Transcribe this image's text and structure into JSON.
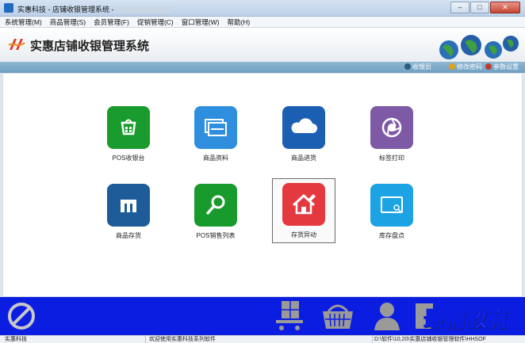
{
  "window": {
    "title": "实惠科技 - 店铺收银管理系统 -",
    "buttons": {
      "minimize": "–",
      "maximize": "□",
      "close": "✕"
    }
  },
  "menu": [
    "系统管理(M)",
    "商品管理(S)",
    "会员管理(F)",
    "促销管理(C)",
    "窗口管理(W)",
    "帮助(H)"
  ],
  "header": {
    "app_name": "实惠店铺收银管理系统",
    "logo_icon": "ss-logo-icon",
    "decor_icon": "globes-icon"
  },
  "toolbar": {
    "cashier": "收银员",
    "change_password": "修改密码",
    "settings": "参数设置"
  },
  "tiles": [
    {
      "label": "POS收银台",
      "icon": "store-bag-icon",
      "color": "#1a9b2e"
    },
    {
      "label": "商品资料",
      "icon": "cards-icon",
      "color": "#2f8fde"
    },
    {
      "label": "商品进货",
      "icon": "cloud-icon",
      "color": "#1b5fb3"
    },
    {
      "label": "标签打印",
      "icon": "aperture-icon",
      "color": "#7e5aa6"
    },
    {
      "label": "商品存货",
      "icon": "m-logo-icon",
      "color": "#1d5c98"
    },
    {
      "label": "POS销售列表",
      "icon": "magnifier-icon",
      "color": "#189a2c"
    },
    {
      "label": "存货异动",
      "icon": "house-pencil-icon",
      "color": "#e3393f"
    },
    {
      "label": "库存盘点",
      "icon": "screen-search-icon",
      "color": "#1ba3e3"
    }
  ],
  "bottom_icons": [
    "no-entry-icon",
    "cart-icon",
    "basket-icon",
    "user-icon",
    "scroll-icon"
  ],
  "watermark": "最需教育",
  "status": {
    "company": "实惠科技",
    "welcome": "欢迎使用实惠科技系列软件",
    "path": "D:\\软件\\10,20\\实惠店铺收银管理软件\\HHSOF"
  }
}
